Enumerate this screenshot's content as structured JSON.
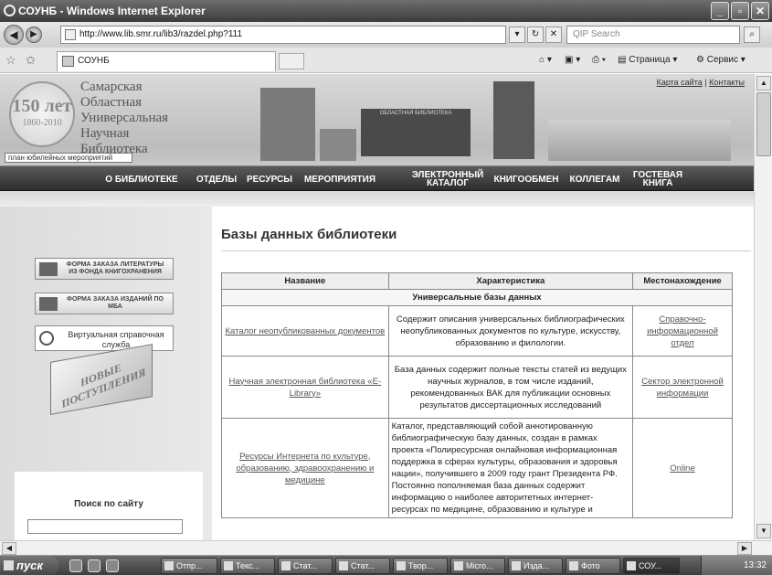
{
  "browser": {
    "title": "СОУНБ - Windows Internet Explorer",
    "url": "http://www.lib.smr.ru/lib3/razdel.php?111",
    "search_placeholder": "QIP Search",
    "tab_title": "СОУНБ",
    "tools": {
      "page": "Страница",
      "service": "Сервис"
    },
    "window_buttons": {
      "minimize": "_",
      "maximize": "▫",
      "close": "✕"
    }
  },
  "site": {
    "library_name": [
      "Самарская",
      "Областная",
      "Универсальная",
      "Научная",
      "Библиотека"
    ],
    "jubilee": {
      "big": "150 лет",
      "years": "1860-2010"
    },
    "plan_link": "план юбилейных мероприятий",
    "top_links": {
      "sitemap": "Карта сайта",
      "sep": "|",
      "contacts": "Контакты"
    },
    "nav": [
      "О БИБЛИОТЕКЕ",
      "ОТДЕЛЫ",
      "РЕСУРСЫ",
      "МЕРОПРИЯТИЯ",
      "ЭЛЕКТРОННЫЙ КАТАЛОГ",
      "КНИГООБМЕН",
      "КОЛЛЕГАМ",
      "ГОСТЕВАЯ КНИГА"
    ],
    "building_sign": "ОБЛАСТНАЯ БИБЛИОТЕКА"
  },
  "sidebar": {
    "order_literature": "ФОРМА ЗАКАЗА ЛИТЕРАТУРЫ ИЗ ФОНДА КНИГОХРАНЕНИЯ",
    "order_mba": "ФОРМА ЗАКАЗА ИЗДАНИЙ ПО МБА",
    "virtual_help": "Виртуальная справочная служба",
    "new_arrivals": "НОВЫЕ ПОСТУПЛЕНИЯ",
    "search_label": "Поиск по сайту"
  },
  "main": {
    "heading": "Базы данных библиотеки",
    "table": {
      "headers": [
        "Название",
        "Характеристика",
        "Местонахождение"
      ],
      "section": "Универсальные базы данных",
      "rows": [
        {
          "name": "Каталог неопубликованных документов",
          "desc": "Содержит описания универсальных библиографических неопубликованных документов по культуре, искусству, образованию и филологии.",
          "location": "Справочно-информационной отдел"
        },
        {
          "name": "Научная электронная библиотека «E-Library»",
          "desc": "База данных содержит полные тексты статей из ведущих научных журналов, в том числе изданий, рекомендованных ВАК для публикации основных результатов диссертационных исследований",
          "location": "Сектор электронной информации"
        },
        {
          "name": "Ресурсы Интернета по культуре, образованию, здравоохранению и медицине",
          "desc": "Каталог, представляющий собой аннотированную библиографическую базу данных, создан в рамках проекта «Полиресурсная онлайновая информационная поддержка в сферах культуры, образования и здоровья нации», получившего в 2009 году грант Президента РФ. Постоянно пополняемая база данных содержит информацию о наиболее авторитетных интернет-ресурсах по медицине, образованию и культуре и",
          "location": "Online"
        }
      ]
    }
  },
  "taskbar": {
    "start": "пуск",
    "tasks": [
      "Отпр...",
      "Текс...",
      "Стат...",
      "Стат...",
      "Твор...",
      "Micro...",
      "Изда...",
      "Фото",
      "СОУ..."
    ],
    "clock": "13:32"
  }
}
